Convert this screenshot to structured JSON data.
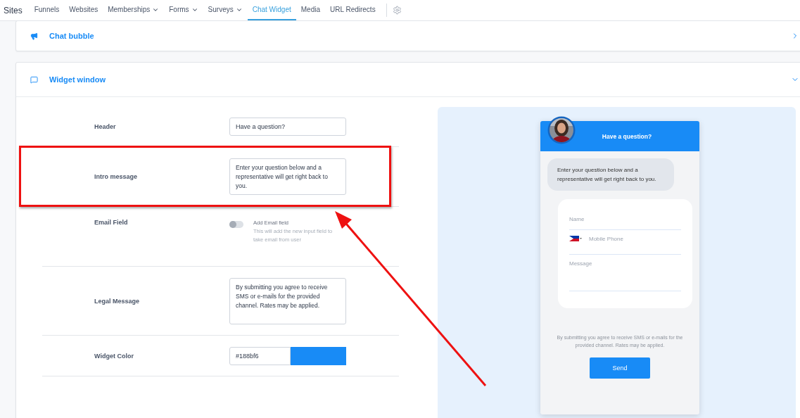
{
  "nav": {
    "title": "Sites",
    "items": [
      {
        "label": "Funnels",
        "dropdown": false,
        "selected": false
      },
      {
        "label": "Websites",
        "dropdown": false,
        "selected": false
      },
      {
        "label": "Memberships",
        "dropdown": true,
        "selected": false
      },
      {
        "label": "Forms",
        "dropdown": true,
        "selected": false
      },
      {
        "label": "Surveys",
        "dropdown": true,
        "selected": false
      },
      {
        "label": "Chat Widget",
        "dropdown": false,
        "selected": true
      },
      {
        "label": "Media",
        "dropdown": false,
        "selected": false
      },
      {
        "label": "URL Redirects",
        "dropdown": false,
        "selected": false
      }
    ]
  },
  "sections": [
    {
      "title": "Chat bubble",
      "kind": "bubble",
      "expanded": false
    },
    {
      "title": "Widget window",
      "kind": "window",
      "expanded": true
    }
  ],
  "settings": [
    {
      "kind": "text",
      "label": "Header",
      "value": "Have a question?"
    },
    {
      "kind": "textarea",
      "label": "Intro message",
      "value": "Enter your question below and a representative will get right back to you."
    },
    {
      "kind": "toggle",
      "label": "Email Field",
      "on": false,
      "toggle_label": "Add Email field",
      "hint": "This will add the new input field to take email from user"
    },
    {
      "kind": "textarea",
      "label": "Legal Message",
      "value": "By submitting you agree to receive SMS or e-mails for the provided channel. Rates may be applied."
    },
    {
      "kind": "color",
      "label": "Widget Color",
      "value": "#188bf6"
    }
  ],
  "preview": {
    "title": "Have a question?",
    "intro": "Enter your question below and a representative will get right back to you.",
    "fields": [
      {
        "kind": "text",
        "placeholder": "Name"
      },
      {
        "kind": "phone",
        "placeholder": "Mobile Phone"
      },
      {
        "kind": "textarea",
        "placeholder": "Message"
      }
    ],
    "legal": "By submitting you agree to receive SMS or e-mails for the provided channel. Rates may be applied.",
    "button": "Send"
  },
  "annotation": {
    "highlight": true,
    "arrow": true
  }
}
